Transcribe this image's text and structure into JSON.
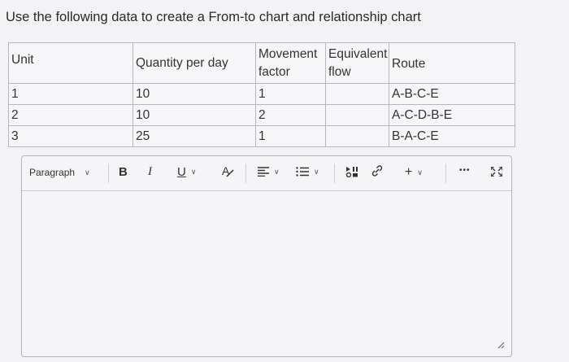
{
  "question": "Use the following data to create a From-to chart and relationship chart",
  "table": {
    "headers": {
      "unit": "Unit",
      "quantity": "Quantity per day",
      "movement_line1": "Movement",
      "movement_line2": "factor",
      "equivalent_line1": "Equivalent",
      "equivalent_line2": "flow",
      "route": "Route"
    },
    "rows": [
      {
        "unit": "1",
        "quantity": "10",
        "movement": "1",
        "equivalent": "",
        "route": "A-B-C-E"
      },
      {
        "unit": "2",
        "quantity": "10",
        "movement": "2",
        "equivalent": "",
        "route": "A-C-D-B-E"
      },
      {
        "unit": "3",
        "quantity": "25",
        "movement": "1",
        "equivalent": "",
        "route": "B-A-C-E"
      }
    ]
  },
  "toolbar": {
    "paragraph": "Paragraph",
    "bold": "B",
    "italic": "I",
    "underline": "U",
    "font_color": "A",
    "more": "•••"
  },
  "editor": {
    "content": ""
  }
}
